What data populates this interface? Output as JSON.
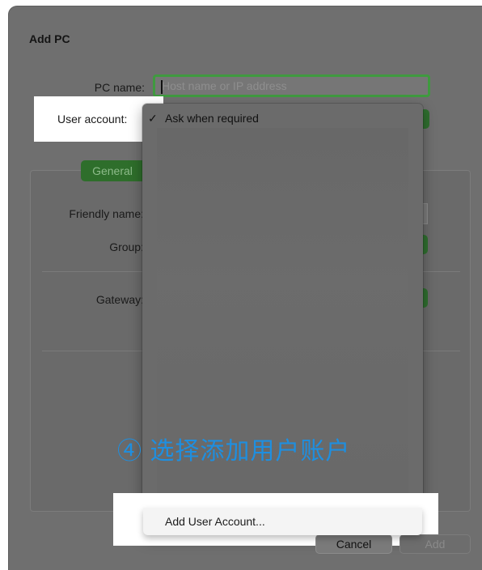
{
  "dialog": {
    "title": "Add PC",
    "pc_name": {
      "label": "PC name:",
      "value": "",
      "placeholder": "Host name or IP address"
    },
    "user_account": {
      "label": "User account:"
    },
    "tabs": [
      {
        "label": "General"
      }
    ],
    "fields": {
      "friendly_name_label": "Friendly name:",
      "group_label": "Group:",
      "gateway_label": "Gateway:"
    },
    "buttons": {
      "cancel": "Cancel",
      "add": "Add"
    }
  },
  "dropdown": {
    "items": [
      {
        "label": "Ask when required",
        "checked": true,
        "check_glyph": "✓"
      },
      {
        "label": "Add User Account..."
      }
    ]
  },
  "annotation": {
    "text": "④ 选择添加用户账户",
    "color": "#1e8fe0"
  },
  "colors": {
    "accent": "#3f9a3f",
    "overlay": "#6f6f6f"
  }
}
